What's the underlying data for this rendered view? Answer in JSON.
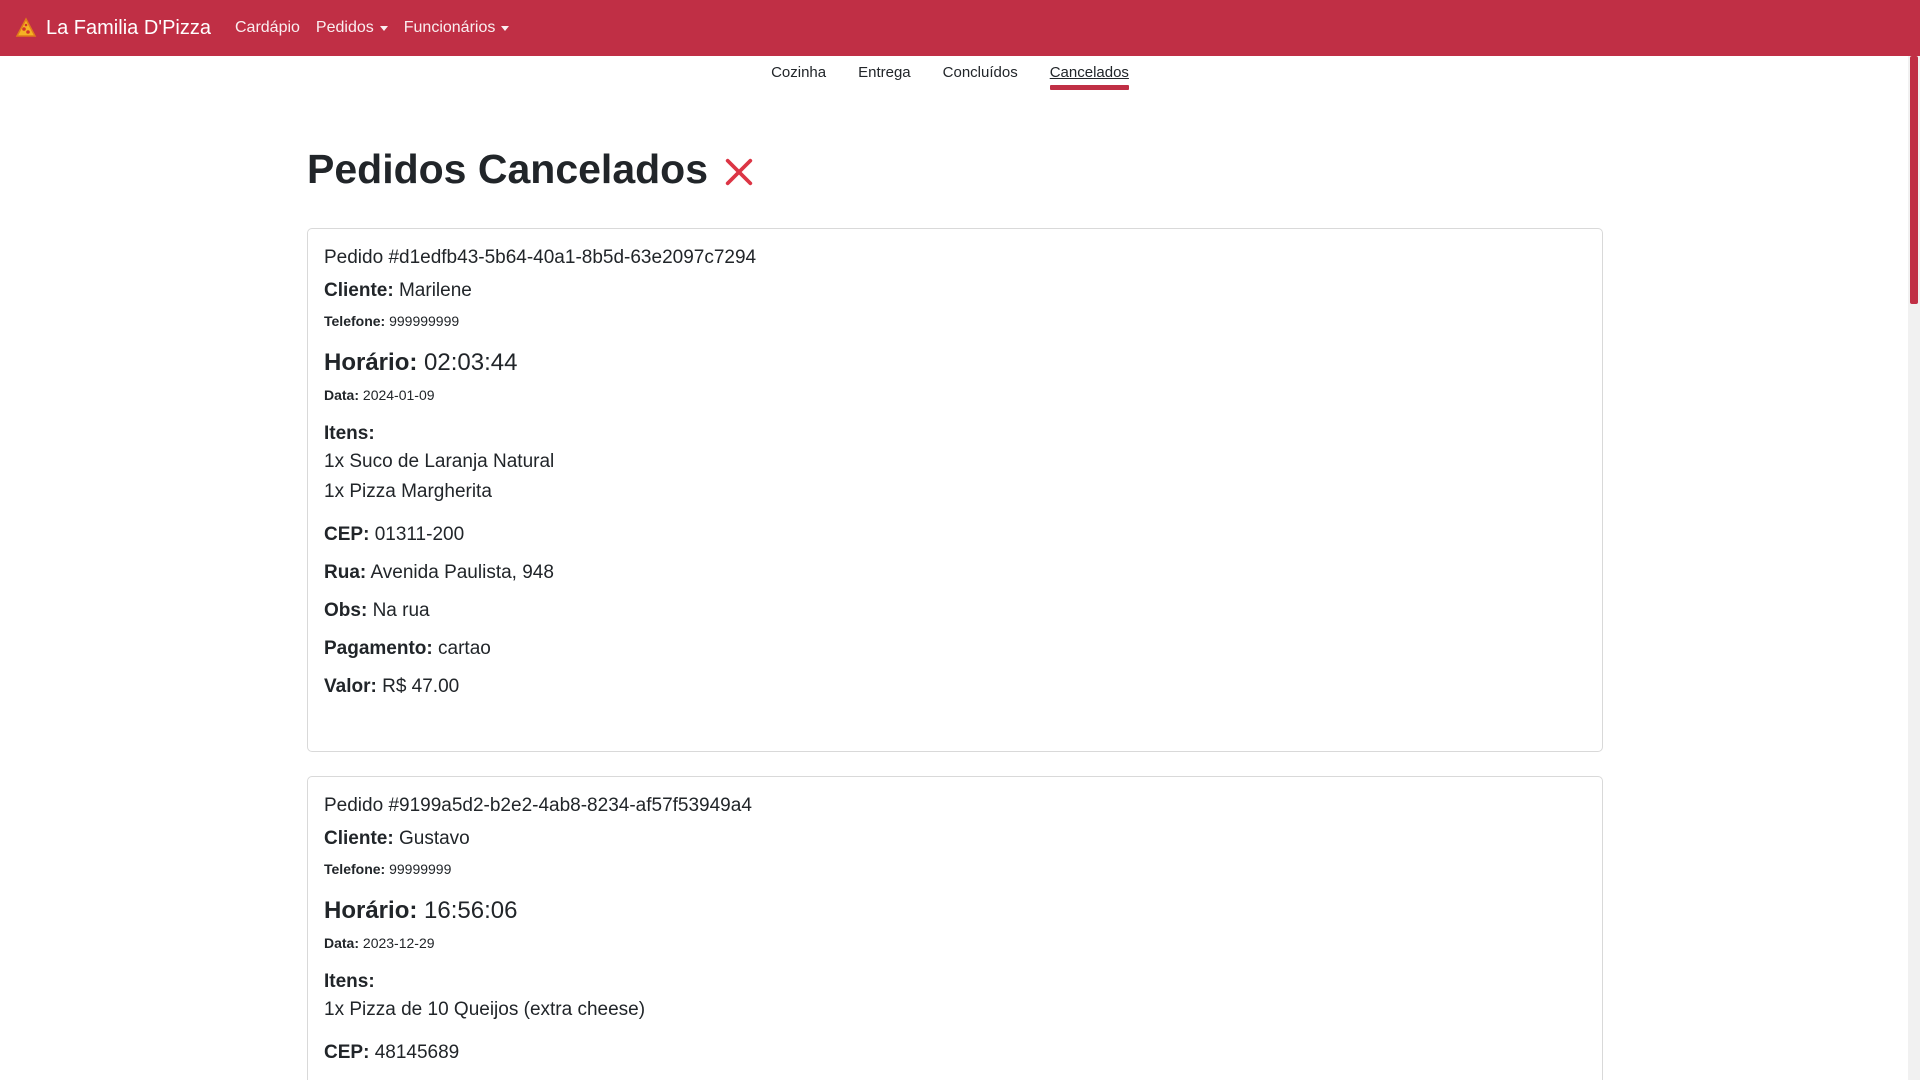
{
  "navbar": {
    "brand": "La Familia D'Pizza",
    "brand_icon": "pizza-icon",
    "links": [
      {
        "label": "Cardápio",
        "dropdown": false
      },
      {
        "label": "Pedidos",
        "dropdown": true
      },
      {
        "label": "Funcionários",
        "dropdown": true
      }
    ],
    "color": "#c02f45"
  },
  "subtabs": [
    {
      "label": "Cozinha",
      "active": false
    },
    {
      "label": "Entrega",
      "active": false
    },
    {
      "label": "Concluídos",
      "active": false
    },
    {
      "label": "Cancelados",
      "active": true
    }
  ],
  "page": {
    "title": "Pedidos Cancelados",
    "title_icon": "x-icon",
    "icon_color": "#dc3545"
  },
  "labels": {
    "cliente": "Cliente:",
    "telefone": "Telefone:",
    "horario": "Horário:",
    "data": "Data:",
    "itens": "Itens:",
    "cep": "CEP:",
    "rua": "Rua:",
    "obs": "Obs:",
    "pagamento": "Pagamento:",
    "valor": "Valor:"
  },
  "orders": [
    {
      "id": "Pedido #d1edfb43-5b64-40a1-8b5d-63e2097c7294",
      "cliente": "Marilene",
      "telefone": "999999999",
      "horario": "02:03:44",
      "data": "2024-01-09",
      "itens": [
        "1x Suco de Laranja Natural",
        "1x Pizza Margherita"
      ],
      "cep": "01311-200",
      "rua": "Avenida Paulista, 948",
      "obs": "Na rua",
      "pagamento": "cartao",
      "valor": "R$ 47.00"
    },
    {
      "id": "Pedido #9199a5d2-b2e2-4ab8-8234-af57f53949a4",
      "cliente": "Gustavo",
      "telefone": "99999999",
      "horario": "16:56:06",
      "data": "2023-12-29",
      "itens": [
        "1x Pizza de 10 Queijos (extra cheese)"
      ],
      "cep": "48145689"
    }
  ]
}
